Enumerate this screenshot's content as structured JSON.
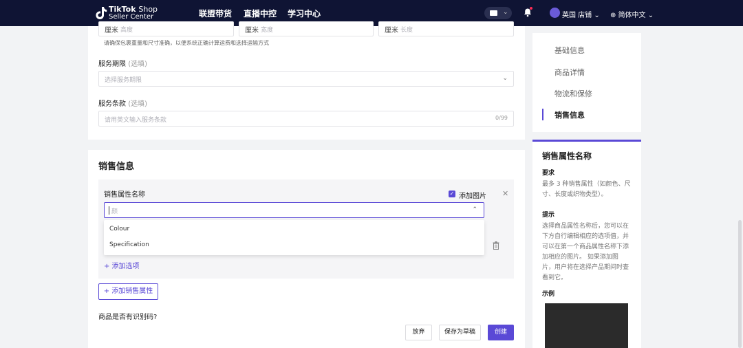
{
  "topbar": {
    "brand_line1": "TikTok",
    "brand_shop": "Shop",
    "brand_line2": "Seller Center",
    "nav": [
      "联盟带货",
      "直播中控",
      "学习中心"
    ],
    "store_name": "英国 店铺",
    "language": "简体中文"
  },
  "dimensions": {
    "fields": [
      {
        "unit": "厘米",
        "placeholder": "高度"
      },
      {
        "unit": "厘米",
        "placeholder": "宽度"
      },
      {
        "unit": "厘米",
        "placeholder": "长度"
      }
    ],
    "help": "请确保包裹重量和尺寸准确，以便系统正确计算运费和选择运输方式"
  },
  "service_period": {
    "label": "服务期限",
    "optional": "(选填)",
    "placeholder": "选择服务期限"
  },
  "service_terms": {
    "label": "服务条款",
    "optional": "(选填)",
    "placeholder": "请用英文输入服务条款",
    "counter": "0/99"
  },
  "sales": {
    "title": "销售信息",
    "attr_label": "销售属性名称",
    "add_image": "添加图片",
    "input_placeholder": "颜",
    "options": [
      "Colour",
      "Specification"
    ],
    "add_option": "+ 添加选项",
    "add_attr": "+ 添加销售属性",
    "question": "商品是否有识别码?"
  },
  "actions": {
    "discard": "放弃",
    "save_draft": "保存为草稿",
    "publish": "创建"
  },
  "right_nav": {
    "items": [
      "基础信息",
      "商品详情",
      "物流和保修",
      "销售信息"
    ],
    "active_index": 3
  },
  "help_panel": {
    "title": "销售属性名称",
    "req_heading": "要求",
    "req_lines": [
      "最多 3 种销售属性（如颜色、尺",
      "寸、长度或织物类型）。"
    ],
    "tip_heading": "提示",
    "tip_lines": [
      "选择商品属性名称后，您可以在",
      "下方自行编辑相应的选项值，并",
      "可以在第一个商品属性名称下添",
      "加相应的图片。 如果添加图",
      "片，用户将在选择产品期间时查",
      "看到它。"
    ],
    "example_heading": "示例"
  },
  "colors": {
    "accent": "#5a49d6",
    "nav_bg": "#0f1434"
  }
}
